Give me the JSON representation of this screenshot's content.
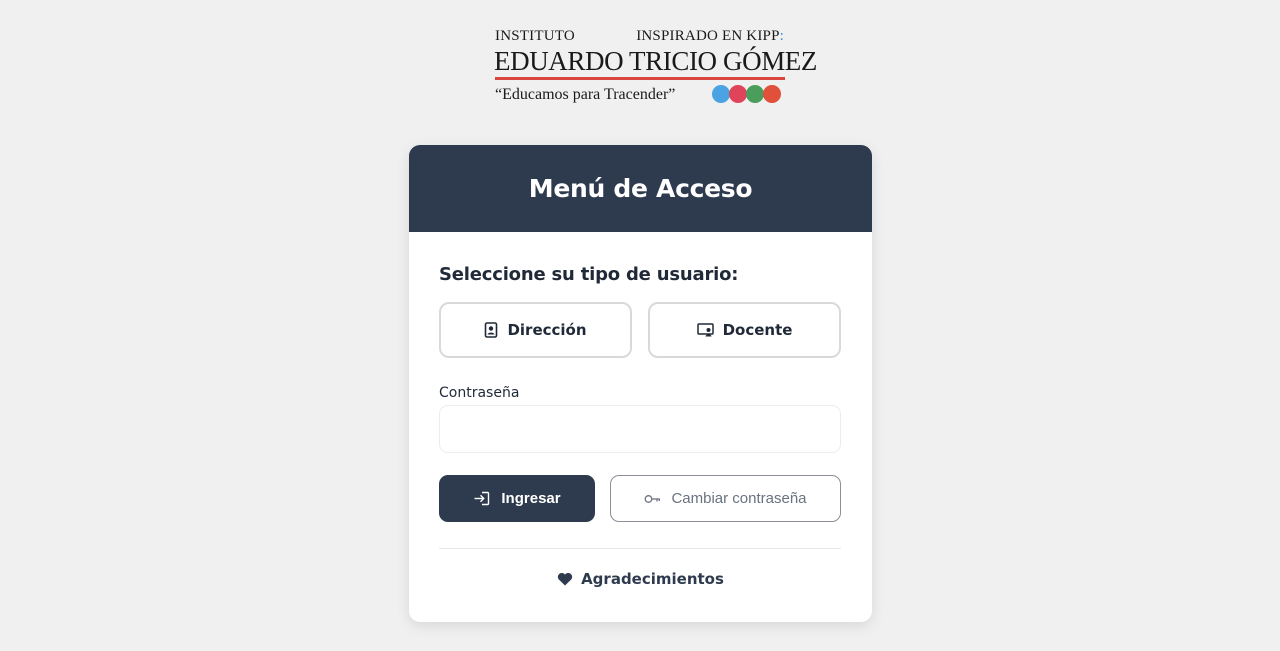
{
  "logo": {
    "top_left": "INSTITUTO",
    "top_right": "INSPIRADO EN KIPP",
    "top_right_mark": ":",
    "name": "EDUARDO TRICIO GÓMEZ",
    "motto": "“Educamos para Tracender”",
    "dot_colors": [
      "#4ba3e3",
      "#e0445a",
      "#4a9d5b",
      "#e0503a"
    ]
  },
  "card": {
    "title": "Menú de Acceso",
    "user_type_label": "Seleccione su tipo de usuario:",
    "roles": [
      {
        "label": "Dirección",
        "icon": "id-badge-icon"
      },
      {
        "label": "Docente",
        "icon": "teacher-board-icon"
      }
    ],
    "password_label": "Contraseña",
    "password_value": "",
    "login_button": {
      "label": "Ingresar",
      "icon": "login-icon"
    },
    "change_password_button": {
      "label": "Cambiar contraseña",
      "icon": "key-icon"
    },
    "acknowledgements": {
      "label": "Agradecimientos",
      "icon": "heart-icon"
    }
  },
  "colors": {
    "header_bg": "#2e3a4e",
    "page_bg": "#f0f0f0",
    "accent_red": "#d9453f"
  }
}
